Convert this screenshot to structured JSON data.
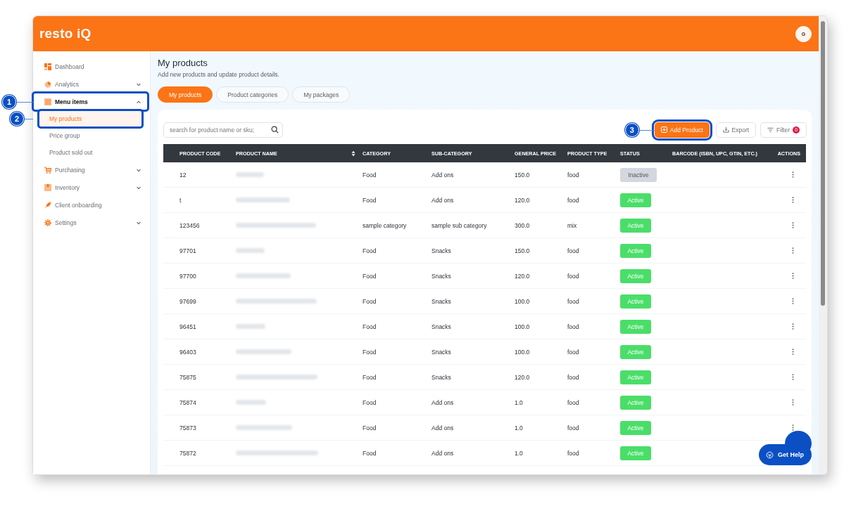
{
  "header": {
    "logo": "resto iQ",
    "avatar": "G"
  },
  "sidebar": {
    "items": [
      {
        "label": "Dashboard",
        "selected": false
      },
      {
        "label": "Analytics",
        "selected": false,
        "expanded": false
      },
      {
        "label": "Menu items",
        "selected": true,
        "expanded": true,
        "callout": "1",
        "children": [
          {
            "label": "My products",
            "selected": true,
            "callout": "2"
          },
          {
            "label": "Price group",
            "selected": false
          },
          {
            "label": "Product sold out",
            "selected": false
          }
        ]
      },
      {
        "label": "Purchasing",
        "selected": false,
        "expanded": false
      },
      {
        "label": "Inventory",
        "selected": false,
        "expanded": false
      },
      {
        "label": "Client onboarding",
        "selected": false
      },
      {
        "label": "Settings",
        "selected": false,
        "expanded": false
      }
    ]
  },
  "page": {
    "title": "My products",
    "subtitle": "Add new products and update product details."
  },
  "tabs": [
    {
      "label": "My products",
      "selected": true
    },
    {
      "label": "Product categories",
      "selected": false
    },
    {
      "label": "My packages",
      "selected": false
    }
  ],
  "search": {
    "placeholder": "search for product name or sku;"
  },
  "actions": {
    "add": {
      "label": "Add Product",
      "callout": "3"
    },
    "export": {
      "label": "Export"
    },
    "filter": {
      "label": "Filter",
      "count": "0"
    }
  },
  "table": {
    "columns": [
      "PRODUCT CODE",
      "PRODUCT NAME",
      "CATEGORY",
      "SUB-CATEGORY",
      "GENERAL PRICE",
      "PRODUCT TYPE",
      "STATUS",
      "BARCODE (ISBN, UPC, GTIN, ETC.)",
      "ACTIONS"
    ],
    "rows": [
      {
        "code": "12",
        "category": "Food",
        "sub_category": "Add ons",
        "price": "150.0",
        "type": "food",
        "status": "Inactive",
        "active": false
      },
      {
        "code": "t",
        "category": "Food",
        "sub_category": "Add ons",
        "price": "120.0",
        "type": "food",
        "status": "Active",
        "active": true
      },
      {
        "code": "123456",
        "category": "sample category",
        "sub_category": "sample sub category",
        "price": "300.0",
        "type": "mix",
        "status": "Active",
        "active": true
      },
      {
        "code": "97701",
        "category": "Food",
        "sub_category": "Snacks",
        "price": "150.0",
        "type": "food",
        "status": "Active",
        "active": true
      },
      {
        "code": "97700",
        "category": "Food",
        "sub_category": "Snacks",
        "price": "120.0",
        "type": "food",
        "status": "Active",
        "active": true
      },
      {
        "code": "97699",
        "category": "Food",
        "sub_category": "Snacks",
        "price": "100.0",
        "type": "food",
        "status": "Active",
        "active": true
      },
      {
        "code": "96451",
        "category": "Food",
        "sub_category": "Snacks",
        "price": "100.0",
        "type": "food",
        "status": "Active",
        "active": true
      },
      {
        "code": "96403",
        "category": "Food",
        "sub_category": "Snacks",
        "price": "100.0",
        "type": "food",
        "status": "Active",
        "active": true
      },
      {
        "code": "75875",
        "category": "Food",
        "sub_category": "Snacks",
        "price": "120.0",
        "type": "food",
        "status": "Active",
        "active": true
      },
      {
        "code": "75874",
        "category": "Food",
        "sub_category": "Add ons",
        "price": "1.0",
        "type": "food",
        "status": "Active",
        "active": true
      },
      {
        "code": "75873",
        "category": "Food",
        "sub_category": "Add ons",
        "price": "1.0",
        "type": "food",
        "status": "Active",
        "active": true
      },
      {
        "code": "75872",
        "category": "Food",
        "sub_category": "Add ons",
        "price": "1.0",
        "type": "food",
        "status": "Active",
        "active": true
      }
    ]
  },
  "help": {
    "label": "Get Help"
  }
}
